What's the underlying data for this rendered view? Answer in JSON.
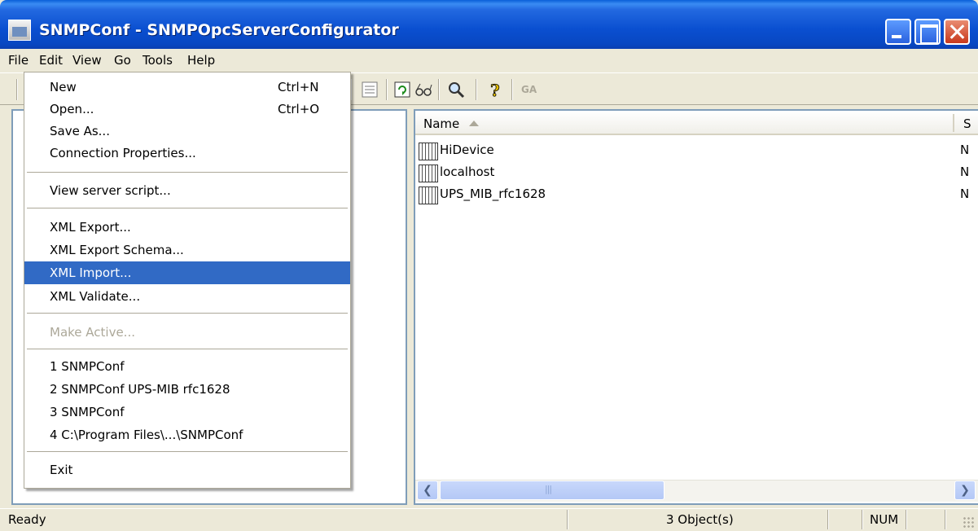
{
  "window": {
    "title": "SNMPConf - SNMPOpcServerConfigurator"
  },
  "menubar": [
    "File",
    "Edit",
    "View",
    "Go",
    "Tools",
    "Help"
  ],
  "toolbar": {
    "ga_label": "GA"
  },
  "file_menu": {
    "new": {
      "label": "New",
      "shortcut": "Ctrl+N"
    },
    "open": {
      "label": "Open...",
      "shortcut": "Ctrl+O"
    },
    "save_as": {
      "label": "Save As..."
    },
    "connection_properties": {
      "label": "Connection Properties..."
    },
    "view_server_script": {
      "label": "View server script..."
    },
    "xml_export": {
      "label": "XML Export..."
    },
    "xml_export_schema": {
      "label": "XML Export Schema..."
    },
    "xml_import": {
      "label": "XML Import..."
    },
    "xml_validate": {
      "label": "XML Validate..."
    },
    "make_active": {
      "label": "Make Active..."
    },
    "recent": [
      "1 SNMPConf",
      "2 SNMPConf UPS-MIB rfc1628",
      "3 SNMPConf",
      "4 C:\\Program Files\\...\\SNMPConf"
    ],
    "exit": {
      "label": "Exit"
    }
  },
  "list": {
    "columns": {
      "name": "Name",
      "second": "S"
    },
    "rows": [
      {
        "name": "HiDevice",
        "status": "N"
      },
      {
        "name": "localhost",
        "status": "N"
      },
      {
        "name": "UPS_MIB_rfc1628",
        "status": "N"
      }
    ]
  },
  "statusbar": {
    "ready": "Ready",
    "count": "3 Object(s)",
    "num": "NUM"
  },
  "colors": {
    "selection": "#316ac5",
    "titlebar": "#0a4fd0",
    "face": "#ece9d8"
  }
}
